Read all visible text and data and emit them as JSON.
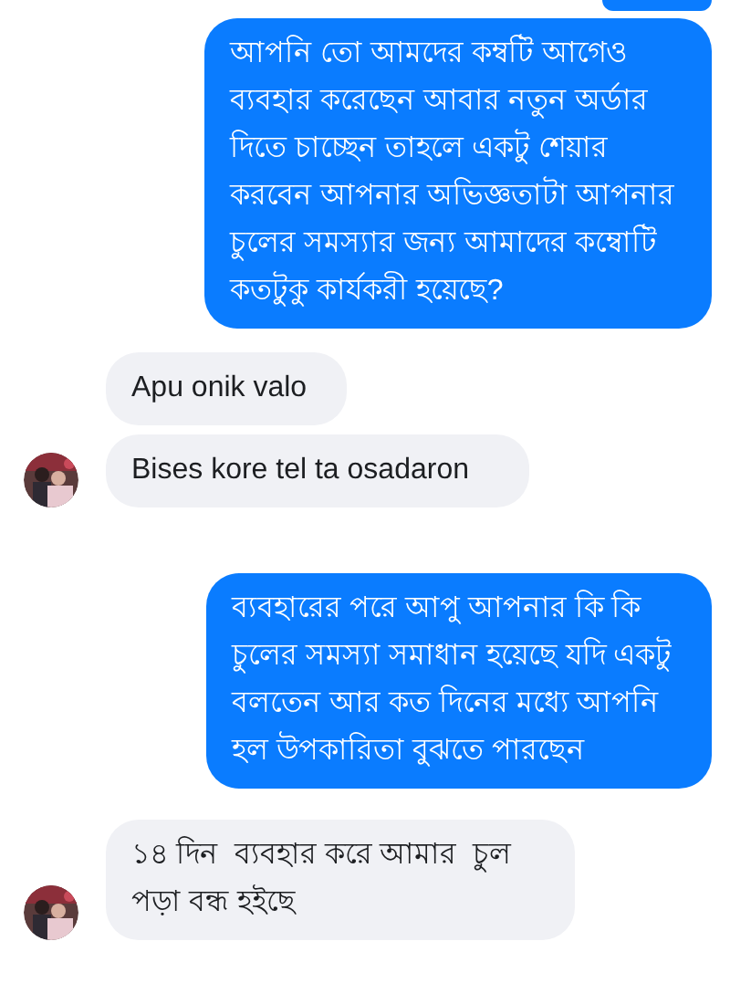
{
  "messages": [
    {
      "kind": "sent",
      "text": "আপনি তো আমদের কম্বটি আগেও ব্যবহার করেছেন আবার নতুন অর্ডার দিতে চাচ্ছেন তাহলে একটু শেয়ার করবেন আপনার অভিজ্ঞতাটা আপনার চুলের সমস্যার জন্য আমাদের কম্বোটি কতটুকু কার্যকরী হয়েছে?",
      "show_avatar": false
    },
    {
      "kind": "received",
      "text": "Apu onik valo",
      "show_avatar": false
    },
    {
      "kind": "received",
      "text": "Bises kore tel ta osadaron",
      "show_avatar": true
    },
    {
      "kind": "sent",
      "text": "ব্যবহারের পরে আপু আপনার কি কি চুলের সমস্যা সমাধান হয়েছে যদি একটু বলতেন আর কত দিনের মধ্যে আপনি হল উপকারিতা বুঝতে পারছেন",
      "show_avatar": false
    },
    {
      "kind": "received",
      "text": "১৪ দিন  ব্যবহার করে আমার  চুল পড়া বন্ধ হইছে",
      "show_avatar": true
    }
  ]
}
